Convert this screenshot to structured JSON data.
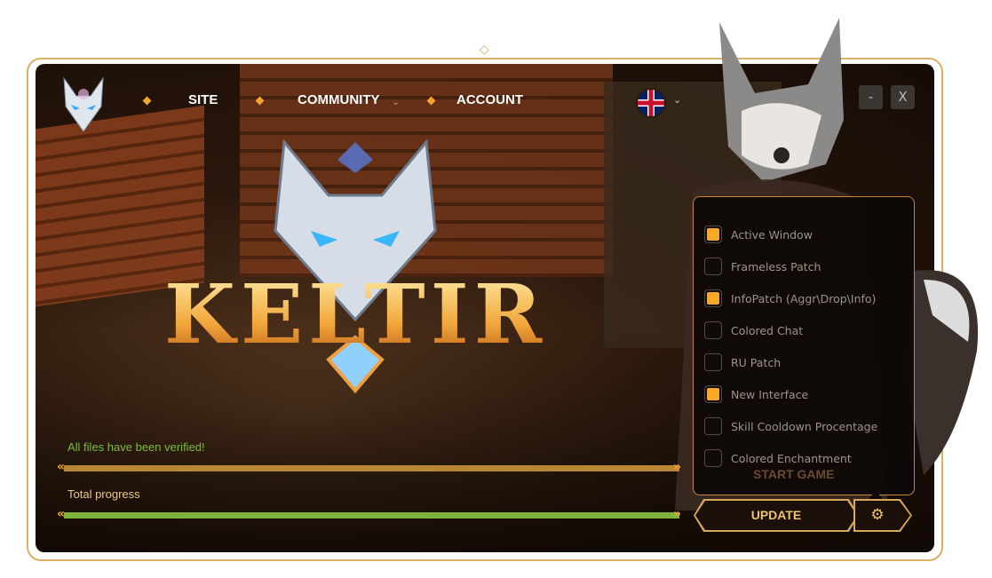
{
  "header": {
    "nav": [
      {
        "label": "SITE"
      },
      {
        "label": "COMMUNITY",
        "has_dropdown": true
      },
      {
        "label": "ACCOUNT"
      }
    ],
    "language": "english-flag-icon",
    "minimize_label": "-",
    "close_label": "X"
  },
  "logo": {
    "text": "KELTIR"
  },
  "progress": {
    "status": "All files have been verified!",
    "file_progress": 100,
    "total_label": "Total progress",
    "total_progress": 100,
    "file_color": "#b98636",
    "total_color": "#7db33a"
  },
  "settings": {
    "items": [
      {
        "label": "Active Window",
        "checked": true
      },
      {
        "label": "Frameless Patch",
        "checked": false
      },
      {
        "label": "InfoPatch (Aggr\\Drop\\Info)",
        "checked": true
      },
      {
        "label": "Colored Chat",
        "checked": false
      },
      {
        "label": "RU Patch",
        "checked": false
      },
      {
        "label": "New Interface",
        "checked": true
      },
      {
        "label": "Skill Cooldown Procentage",
        "checked": false
      },
      {
        "label": "Colored Enchantment",
        "checked": false
      }
    ]
  },
  "actions": {
    "update_label": "UPDATE",
    "start_label": "START GAME",
    "gear": "gear-icon"
  },
  "colors": {
    "accent": "#f9a825",
    "border": "#dcae66"
  }
}
